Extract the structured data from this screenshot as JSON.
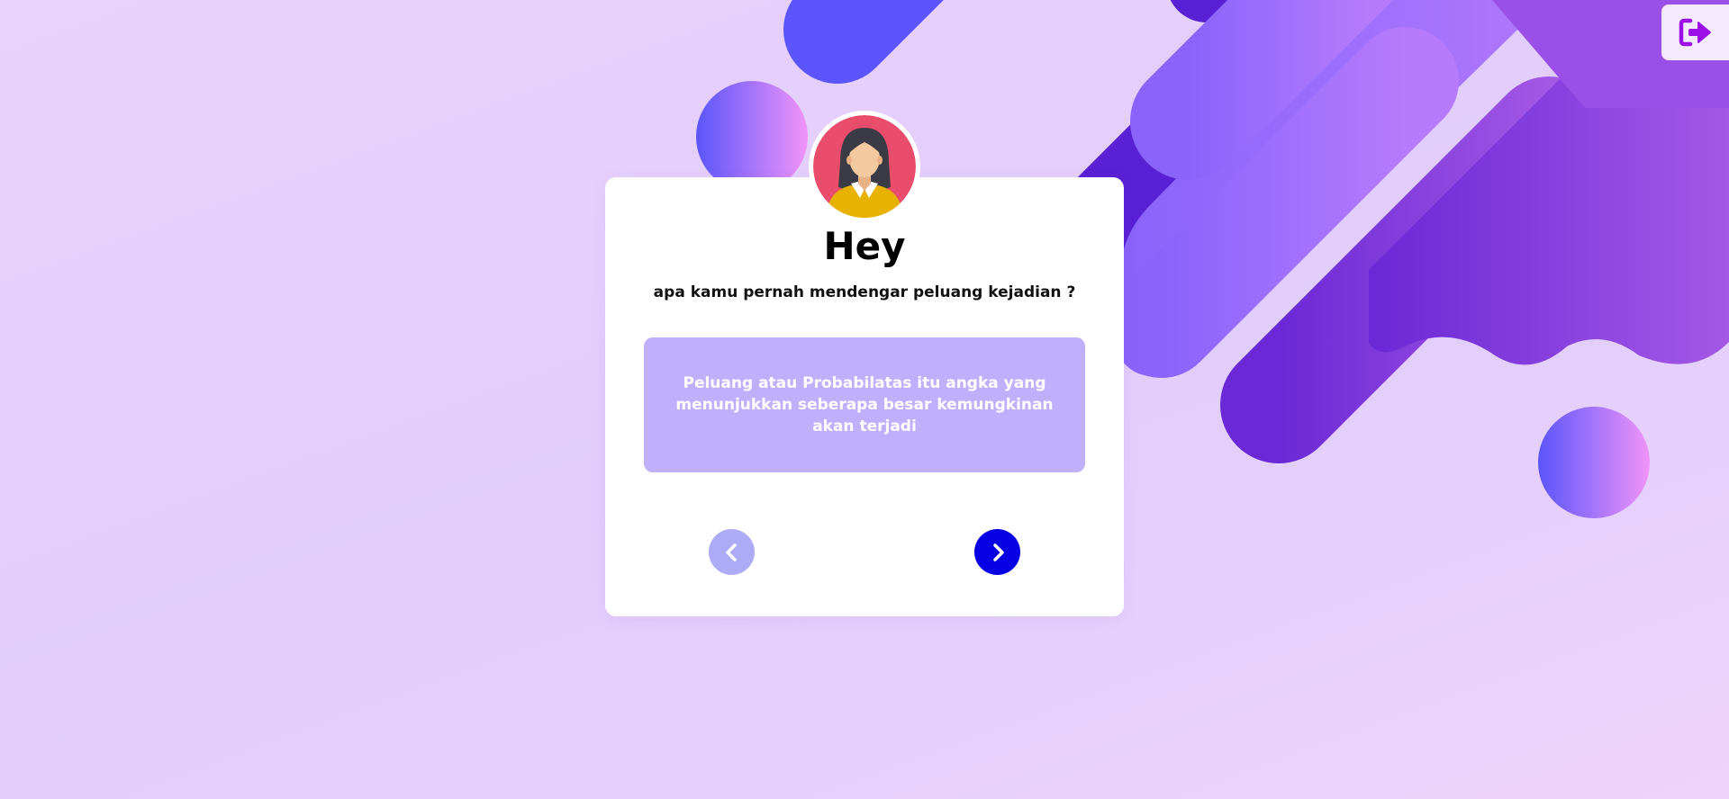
{
  "card": {
    "title": "Hey",
    "question": "apa kamu pernah mendengar peluang kejadian ?",
    "info_text": "Peluang atau Probabilatas itu angka yang menunjukkan seberapa besar kemungkinan akan terjadi"
  },
  "icons": {
    "logout": "sign-out-icon",
    "avatar": "woman-avatar-icon",
    "prev": "chevron-left-icon",
    "next": "chevron-right-icon"
  },
  "colors": {
    "page_background": "#e6cffb",
    "info_box": "#c0b0fc",
    "next_button": "#0700e5",
    "prev_button": "#adaaf6",
    "logout_icon": "#9b10e6",
    "avatar_circle": "#ea4d6c",
    "avatar_shirt": "#e7b300"
  }
}
